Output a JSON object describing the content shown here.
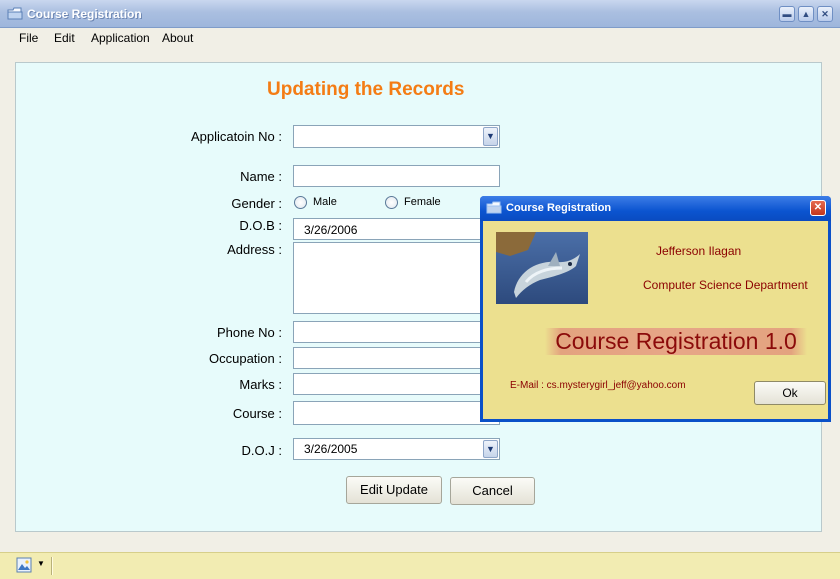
{
  "window": {
    "title": "Course Registration"
  },
  "menu": [
    "File",
    "Edit",
    "Application",
    "About"
  ],
  "form": {
    "title": "Updating the Records",
    "labels": {
      "application_no": "Applicatoin No :",
      "name": "Name :",
      "gender": "Gender :",
      "dob": "D.O.B :",
      "address": "Address :",
      "phone": "Phone No :",
      "occupation": "Occupation :",
      "marks": "Marks :",
      "course": "Course :",
      "doj": "D.O.J :"
    },
    "gender_options": {
      "male": "Male",
      "female": "Female"
    },
    "dob_value": "3/26/2006",
    "doj_value": "3/26/2005",
    "buttons": {
      "edit_update": "Edit Update",
      "cancel": "Cancel"
    }
  },
  "dialog": {
    "title": "Course Registration",
    "author": "Jefferson Ilagan",
    "department": "Computer Science Department",
    "product": "Course Registration 1.0",
    "email": "E-Mail : cs.mysterygirl_jeff@yahoo.com",
    "ok": "Ok"
  },
  "colors": {
    "title_orange": "#f47c14",
    "dialog_blue": "#0a50c8",
    "dialog_bg": "#ece08f",
    "content_bg": "#e7fbfb"
  }
}
